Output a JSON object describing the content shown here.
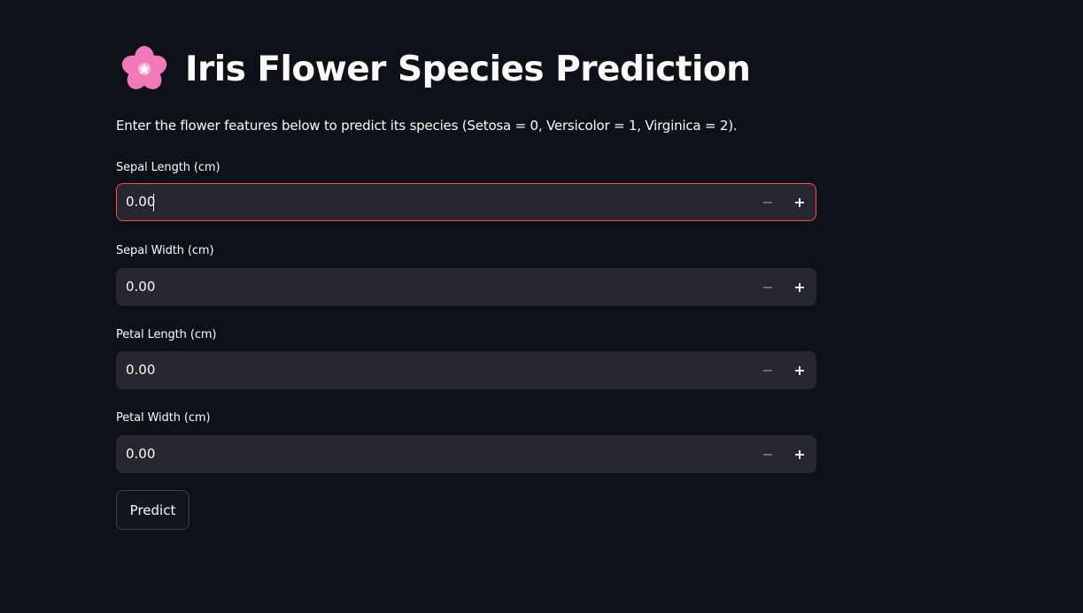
{
  "page": {
    "title_emoji": "cherry-blossom-icon",
    "title": "Iris Flower Species Prediction",
    "intro": "Enter the flower features below to predict its species (Setosa = 0, Versicolor = 1, Virginica = 2)."
  },
  "fields": [
    {
      "label": "Sepal Length (cm)",
      "value": "0.00",
      "focused": true
    },
    {
      "label": "Sepal Width (cm)",
      "value": "0.00",
      "focused": false
    },
    {
      "label": "Petal Length (cm)",
      "value": "0.00",
      "focused": false
    },
    {
      "label": "Petal Width (cm)",
      "value": "0.00",
      "focused": false
    }
  ],
  "actions": {
    "predict_label": "Predict"
  },
  "colors": {
    "background": "#0e1117",
    "input_background": "#262730",
    "focus_border": "#ff4b4b",
    "text": "#fafafa",
    "emoji_pink": "#f27aba"
  }
}
